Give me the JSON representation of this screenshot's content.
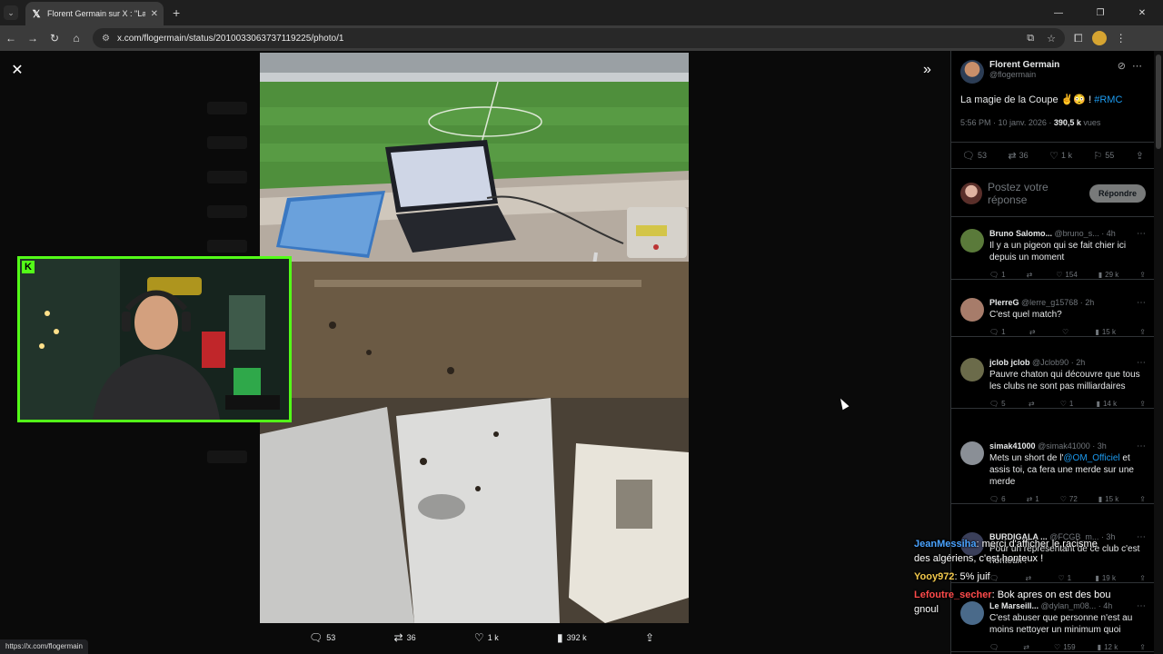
{
  "browser": {
    "tab_title": "Florent Germain sur X : \"La mag",
    "tab_icon": "x-logo",
    "url": "x.com/flogermain/status/2010033063737119225/photo/1",
    "status_url": "https://x.com/flogermain"
  },
  "photo_actions": {
    "replies": "53",
    "reposts": "36",
    "likes": "1 k",
    "views": "392 k"
  },
  "tweet": {
    "author_name": "Florent Germain",
    "author_handle": "@flogermain",
    "text": "La magie de la Coupe ✌️😳 ! ",
    "hashtag": "#RMC",
    "time": "5:56 PM · 10 janv. 2026 · ",
    "views_count": "390,5 k",
    "views_label": " vues",
    "stats": {
      "replies": "53",
      "reposts": "36",
      "likes": "1 k",
      "bookmarks": "55"
    },
    "reply_placeholder": "Postez votre réponse",
    "reply_button": "Répondre"
  },
  "replies": [
    {
      "name": "Bruno Salomo...",
      "handle": "@bruno_s...",
      "time": "· 4h",
      "text": "Il y a un pigeon qui se fait chier ici depuis un moment",
      "replies": "1",
      "reposts": "",
      "likes": "154",
      "views": "29 k",
      "avatar_color": "#5a7a3a"
    },
    {
      "name": "PIerreG",
      "handle": "@lerre_g15768",
      "time": "· 2h",
      "text": "C'est quel match?",
      "replies": "1",
      "reposts": "",
      "likes": "",
      "views": "15 k",
      "avatar_color": "#a77c6a"
    },
    {
      "name": "jclob jclob",
      "handle": "@Jclob90",
      "time": "· 2h",
      "text": "Pauvre chaton qui découvre que tous les clubs ne sont pas milliardaires",
      "replies": "5",
      "reposts": "",
      "likes": "1",
      "views": "14 k",
      "avatar_color": "#6b6b4a"
    },
    {
      "name": "simak41000",
      "handle": "@simak41000",
      "time": "· 3h",
      "text_before": "Mets un short de l'",
      "mention": "@OM_Officiel",
      "text_after": " et assis toi, ca fera une merde sur une merde",
      "replies": "6",
      "reposts": "1",
      "likes": "72",
      "views": "15 k",
      "avatar_color": "#8a8f96"
    },
    {
      "name": "BURDIGALA ...",
      "handle": "@FCGB_m...",
      "time": "· 3h",
      "text": "Pour un représentant de ce club c'est honteux !",
      "replies": "",
      "reposts": "",
      "likes": "1",
      "views": "19 k",
      "avatar_color": "#3a3f5a"
    },
    {
      "name": "Le Marseill...",
      "handle": "@dylan_m08...",
      "time": "· 4h",
      "text": "C'est abuser que personne n'est au moins nettoyer un minimum quoi",
      "replies": "",
      "reposts": "",
      "likes": "159",
      "views": "12 k",
      "avatar_color": "#4a6a8a"
    }
  ],
  "chat": [
    {
      "user": "JeanMessiha",
      "text": ": merci d'afficher le racisme des algériens, c'est honteux !"
    },
    {
      "user": "Yooy972",
      "text": ": 5% juif"
    },
    {
      "user": "Lefoutre_secher",
      "text": ": Bok apres on est des bou gnoul"
    }
  ],
  "colors": {
    "kick_green": "#53fc18",
    "x_blue": "#1d9bf0",
    "muted": "#71767b"
  }
}
